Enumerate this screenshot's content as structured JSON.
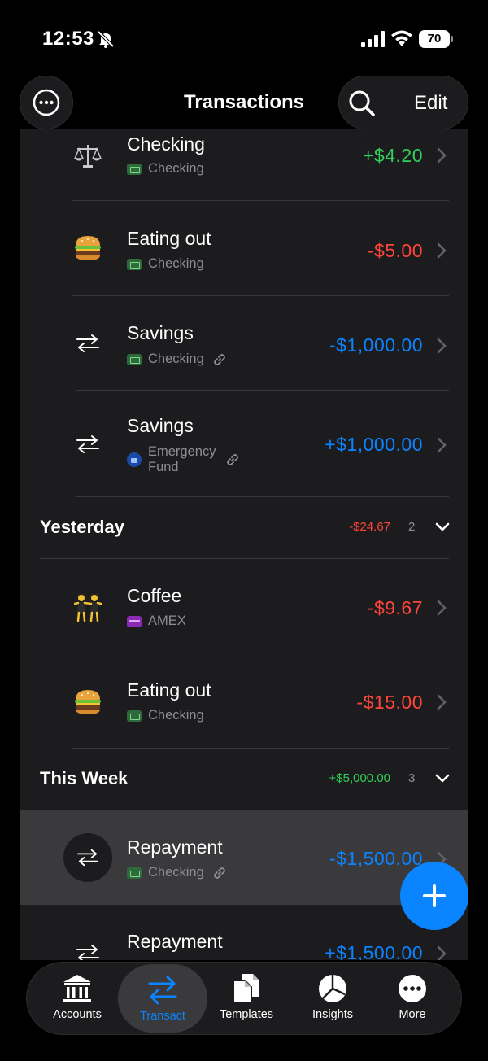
{
  "status": {
    "time": "12:53",
    "battery": "70"
  },
  "nav": {
    "title": "Transactions",
    "edit_label": "Edit"
  },
  "rows_top": [
    {
      "title": "Checking",
      "account": "Checking",
      "amount": "+$4.20",
      "icon": "balance-scale-icon"
    },
    {
      "title": "Eating out",
      "account": "Checking",
      "amount": "-$5.00",
      "icon": "hamburger-icon"
    },
    {
      "title": "Savings",
      "account": "Checking",
      "amount": "-$1,000.00",
      "icon": "transfer-icon"
    },
    {
      "title": "Savings",
      "account": "Emergency Fund",
      "account_line1": "Emergency",
      "account_line2": "Fund",
      "amount": "+$1,000.00",
      "icon": "transfer-icon"
    }
  ],
  "yesterday": {
    "title": "Yesterday",
    "total": "-$24.67",
    "count": "2",
    "rows": [
      {
        "title": "Coffee",
        "account": "AMEX",
        "amount": "-$9.67",
        "icon": "dancers-icon"
      },
      {
        "title": "Eating out",
        "account": "Checking",
        "amount": "-$15.00",
        "icon": "hamburger-icon"
      }
    ]
  },
  "this_week": {
    "title": "This Week",
    "total": "+$5,000.00",
    "count": "3",
    "rows": [
      {
        "title": "Repayment",
        "account": "Checking",
        "amount": "-$1,500.00",
        "icon": "transfer-icon"
      },
      {
        "title": "Repayment",
        "account": "",
        "amount": "+$1,500.00",
        "icon": "transfer-icon"
      }
    ]
  },
  "tabs": [
    {
      "label": "Accounts",
      "icon": "bank-icon"
    },
    {
      "label": "Transact",
      "icon": "transfer-icon"
    },
    {
      "label": "Templates",
      "icon": "documents-icon"
    },
    {
      "label": "Insights",
      "icon": "pie-chart-icon"
    },
    {
      "label": "More",
      "icon": "more-icon"
    }
  ],
  "colors": {
    "income": "#30d158",
    "expense": "#ff453a",
    "transfer": "#0a84ff",
    "accent": "#0a84ff"
  }
}
